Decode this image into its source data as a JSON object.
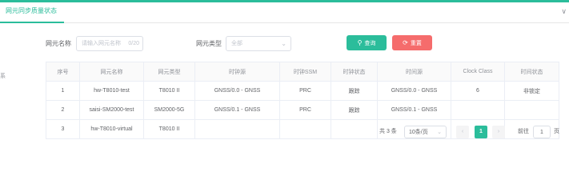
{
  "tabs": {
    "active_label": "网元同步质量状态",
    "chevron": "∨"
  },
  "filters": {
    "ne_name_label": "网元名称",
    "ne_name_placeholder": "请输入网元名称",
    "ne_name_counter": "0/20",
    "ne_type_label": "网元类型",
    "ne_type_value": "全部",
    "query_label": "查询",
    "reset_label": "重置"
  },
  "edge_text": "系",
  "table": {
    "headers": [
      "序号",
      "网元名称",
      "网元类型",
      "时钟源",
      "时钟SSM",
      "时钟状态",
      "时间源",
      "Clock Class",
      "时间状态"
    ],
    "rows": [
      [
        "1",
        "hw-T8010-test",
        "T8010 II",
        "GNSS/0.0 - GNSS",
        "PRC",
        "跟踪",
        "GNSS/0.0 - GNSS",
        "6",
        "非锁定"
      ],
      [
        "2",
        "saisi-SM2000-test",
        "SM2000-5G",
        "GNSS/0.1 - GNSS",
        "PRC",
        "跟踪",
        "GNSS/0.1 - GNSS",
        "",
        ""
      ],
      [
        "3",
        "hw-T8010-virtual",
        "T8010 II",
        "",
        "",
        "",
        "",
        "",
        ""
      ]
    ]
  },
  "pagination": {
    "total_text": "共 3 条",
    "page_size": "10条/页",
    "prev_icon": "‹",
    "current_page": "1",
    "next_icon": "›",
    "goto_label": "前往",
    "goto_value": "1",
    "page_suffix": "页"
  },
  "colors": {
    "accent": "#2bbd9b",
    "danger": "#f56c6c"
  }
}
